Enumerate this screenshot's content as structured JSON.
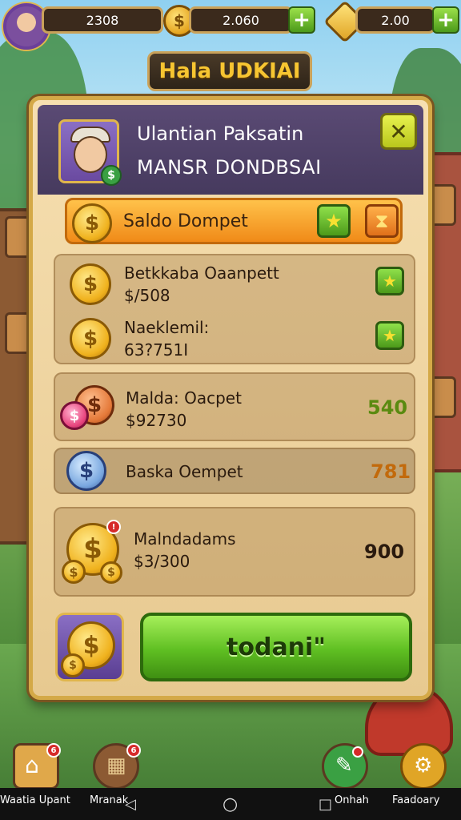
{
  "hud": {
    "currency1_value": "2308",
    "currency2_value": "2.060",
    "currency3_value": "2.00",
    "plus_label": "+"
  },
  "title": "Hala UDKIAI",
  "header": {
    "line1": "Ulantian Paksatin",
    "line2": "MANSR DONDBSAI",
    "close_label": "✕"
  },
  "saldo": {
    "label": "Saldo Dompet"
  },
  "items": [
    {
      "title": "Betkkaba Oaanpett",
      "sub": "$/508",
      "value": ""
    },
    {
      "title": "Naeklemil:",
      "sub": "63?751I",
      "value": ""
    },
    {
      "title": "Malda: Oacpet",
      "sub": "$92730",
      "value": "540"
    },
    {
      "title": "Baska Oempet",
      "sub": "",
      "value": "781"
    },
    {
      "title": "Malndadams",
      "sub": "$3/300",
      "value": "900"
    }
  ],
  "confirm_label": "todani\"",
  "bottom_nav": {
    "labels": [
      "Waatia Upant",
      "Mranak",
      "Onhah",
      "Faadoary"
    ]
  },
  "sys": {
    "back": "◁",
    "home": "○",
    "recent": "□"
  },
  "colors": {
    "accent_gold": "#e0b64c",
    "panel_bg": "#f6dfb0",
    "header_purple": "#5a4a74",
    "confirm_green": "#5fbf22",
    "saldo_orange": "#f08a18",
    "value_green": "#5a8a10",
    "value_orange": "#c26a0c"
  }
}
